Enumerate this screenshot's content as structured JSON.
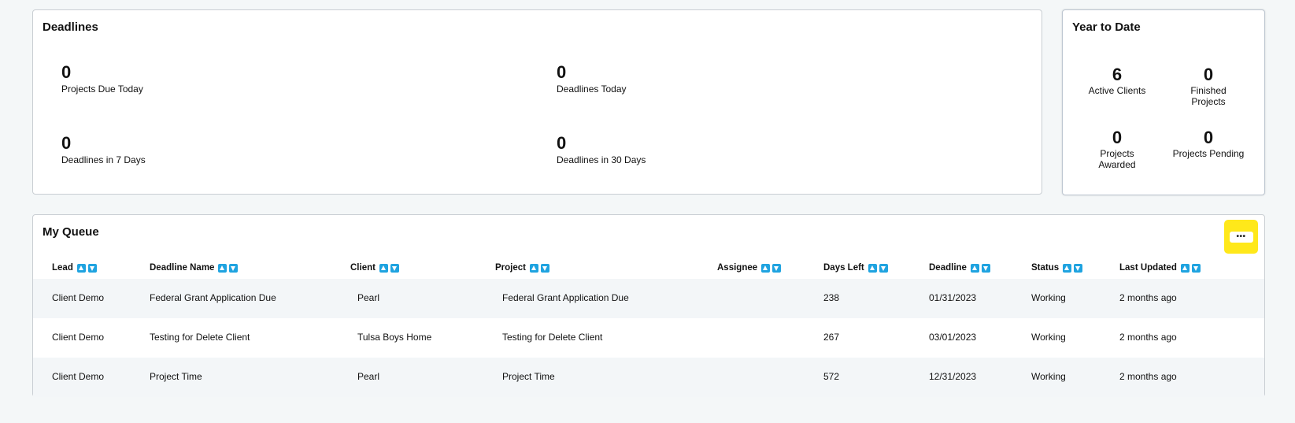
{
  "deadlines": {
    "title": "Deadlines",
    "stats": [
      {
        "value": "0",
        "label": "Projects Due Today"
      },
      {
        "value": "0",
        "label": "Deadlines Today"
      },
      {
        "value": "0",
        "label": "Deadlines in 7 Days"
      },
      {
        "value": "0",
        "label": "Deadlines in 30 Days"
      }
    ]
  },
  "ytd": {
    "title": "Year to Date",
    "stats": [
      {
        "value": "6",
        "label": "Active Clients"
      },
      {
        "value": "0",
        "label": "Finished Projects"
      },
      {
        "value": "0",
        "label": "Projects Awarded"
      },
      {
        "value": "0",
        "label": "Projects Pending"
      }
    ]
  },
  "queue": {
    "title": "My Queue",
    "menu_button": "•••",
    "columns": [
      "Lead",
      "Deadline Name",
      "Client",
      "Project",
      "Assignee",
      "Days Left",
      "Deadline",
      "Status",
      "Last Updated"
    ],
    "rows": [
      {
        "lead": "Client Demo",
        "deadline_name": "Federal Grant Application Due",
        "client": "Pearl",
        "project": "Federal Grant Application Due",
        "assignee": "",
        "days_left": "238",
        "deadline": "01/31/2023",
        "status": "Working",
        "last_updated": "2 months ago"
      },
      {
        "lead": "Client Demo",
        "deadline_name": "Testing for Delete Client",
        "client": "Tulsa Boys Home",
        "project": "Testing for Delete Client",
        "assignee": "",
        "days_left": "267",
        "deadline": "03/01/2023",
        "status": "Working",
        "last_updated": "2 months ago"
      },
      {
        "lead": "Client Demo",
        "deadline_name": "Project Time",
        "client": "Pearl",
        "project": "Project Time",
        "assignee": "",
        "days_left": "572",
        "deadline": "12/31/2023",
        "status": "Working",
        "last_updated": "2 months ago"
      }
    ]
  },
  "colors": {
    "sort_icon": "#1fa3e0",
    "highlight": "#ffe81a",
    "alt_row": "#f3f6f8"
  }
}
